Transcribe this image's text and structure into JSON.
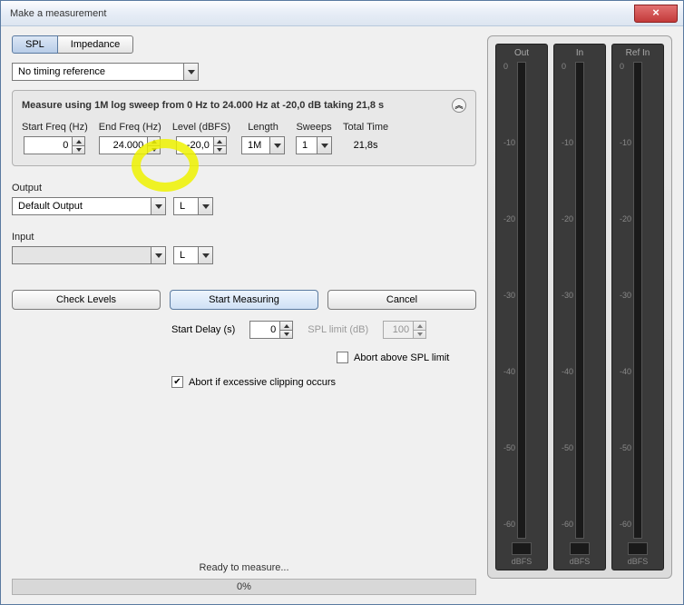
{
  "window": {
    "title": "Make a measurement"
  },
  "tabs": {
    "spl": "SPL",
    "impedance": "Impedance"
  },
  "timing_ref": {
    "value": "No timing reference"
  },
  "sweep": {
    "summary": "Measure using 1M log sweep from 0 Hz to 24.000 Hz at -20,0 dB taking 21,8 s",
    "start_freq_label": "Start Freq (Hz)",
    "start_freq": "0",
    "end_freq_label": "End Freq (Hz)",
    "end_freq": "24.000",
    "level_label": "Level (dBFS)",
    "level": "-20,0",
    "length_label": "Length",
    "length": "1M",
    "sweeps_label": "Sweeps",
    "sweeps": "1",
    "total_label": "Total Time",
    "total": "21,8s"
  },
  "output": {
    "label": "Output",
    "device": "Default Output",
    "channel": "L"
  },
  "input": {
    "label": "Input",
    "device": "",
    "channel": "L"
  },
  "buttons": {
    "check": "Check Levels",
    "start": "Start Measuring",
    "cancel": "Cancel"
  },
  "delay": {
    "label": "Start Delay (s)",
    "value": "0"
  },
  "spl_limit": {
    "label": "SPL limit (dB)",
    "value": "100"
  },
  "abort_spl": {
    "label": "Abort above SPL limit",
    "checked": false
  },
  "abort_clip": {
    "label": "Abort if excessive clipping occurs",
    "checked": true
  },
  "status": {
    "text": "Ready to measure...",
    "progress": "0%"
  },
  "meters": {
    "items": [
      {
        "title": "Out",
        "unit": "dBFS"
      },
      {
        "title": "In",
        "unit": "dBFS"
      },
      {
        "title": "Ref In",
        "unit": "dBFS"
      }
    ],
    "ticks": [
      "0",
      "-10",
      "-20",
      "-30",
      "-40",
      "-50",
      "-60"
    ]
  }
}
